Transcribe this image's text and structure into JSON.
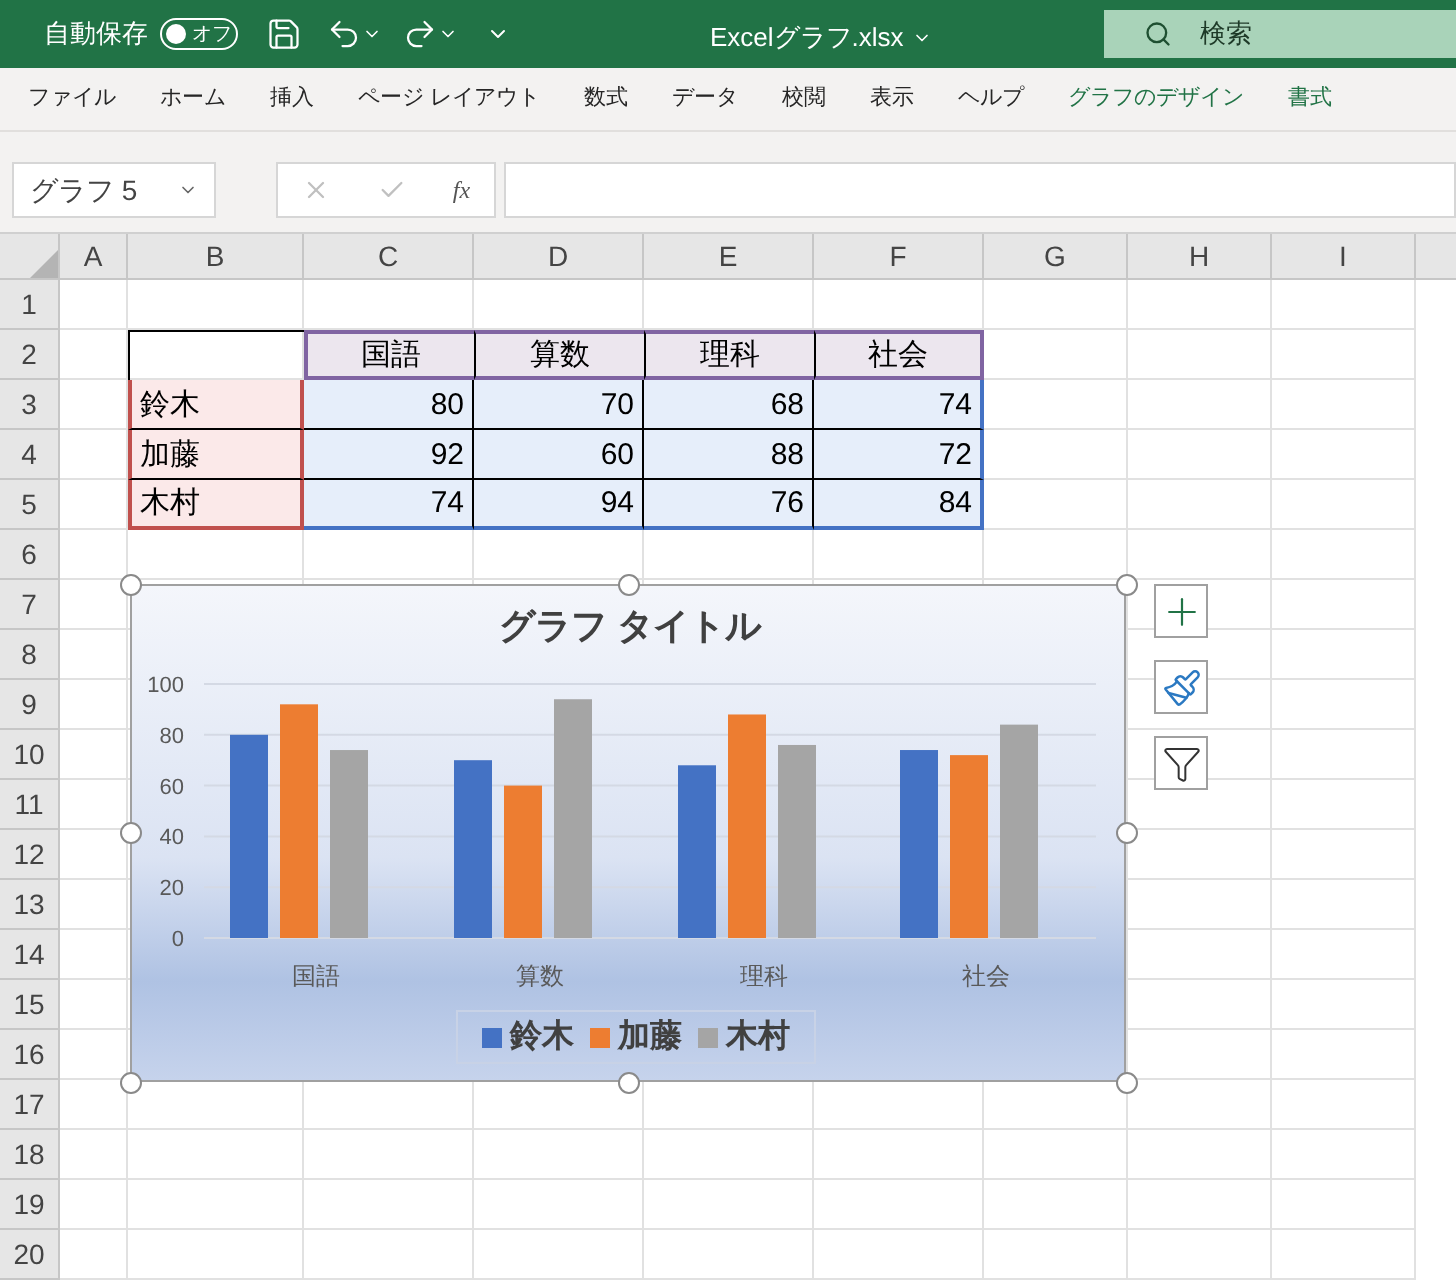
{
  "title_bar": {
    "autosave_label": "自動保存",
    "autosave_toggle": {
      "label": "オフ",
      "on": false
    },
    "filename": "Excelグラフ.xlsx",
    "search_placeholder": "検索"
  },
  "ribbon_tabs": [
    {
      "label": "ファイル",
      "contextual": false
    },
    {
      "label": "ホーム",
      "contextual": false
    },
    {
      "label": "挿入",
      "contextual": false
    },
    {
      "label": "ページ レイアウト",
      "contextual": false
    },
    {
      "label": "数式",
      "contextual": false
    },
    {
      "label": "データ",
      "contextual": false
    },
    {
      "label": "校閲",
      "contextual": false
    },
    {
      "label": "表示",
      "contextual": false
    },
    {
      "label": "ヘルプ",
      "contextual": false
    },
    {
      "label": "グラフのデザイン",
      "contextual": true
    },
    {
      "label": "書式",
      "contextual": true
    }
  ],
  "formula_bar": {
    "name_box": "グラフ 5",
    "fx": "fx"
  },
  "sheet": {
    "column_headers": [
      "A",
      "B",
      "C",
      "D",
      "E",
      "F",
      "G",
      "H",
      "I"
    ],
    "row_headers": [
      "1",
      "2",
      "3",
      "4",
      "5",
      "6",
      "7",
      "8",
      "9",
      "10",
      "11",
      "12",
      "13",
      "14",
      "15",
      "16",
      "17",
      "18",
      "19",
      "20"
    ],
    "table": {
      "header": [
        "国語",
        "算数",
        "理科",
        "社会"
      ],
      "rows": [
        {
          "name": "鈴木",
          "values": [
            "80",
            "70",
            "68",
            "74"
          ]
        },
        {
          "name": "加藤",
          "values": [
            "92",
            "60",
            "88",
            "72"
          ]
        },
        {
          "name": "木村",
          "values": [
            "74",
            "94",
            "76",
            "84"
          ]
        }
      ]
    }
  },
  "chart": {
    "chart_data": {
      "type": "bar",
      "title": "グラフ タイトル",
      "categories": [
        "国語",
        "算数",
        "理科",
        "社会"
      ],
      "series": [
        {
          "name": "鈴木",
          "color": "#4472c4",
          "values": [
            80,
            70,
            68,
            74
          ]
        },
        {
          "name": "加藤",
          "color": "#ed7d31",
          "values": [
            92,
            60,
            88,
            72
          ]
        },
        {
          "name": "木村",
          "color": "#a5a5a5",
          "values": [
            74,
            94,
            76,
            84
          ]
        }
      ],
      "ylim": [
        0,
        100
      ],
      "yticks": [
        {
          "value": 0,
          "label": "0"
        },
        {
          "value": 20,
          "label": "20"
        },
        {
          "value": 40,
          "label": "40"
        },
        {
          "value": 60,
          "label": "60"
        },
        {
          "value": 80,
          "label": "80"
        },
        {
          "value": 100,
          "label": "100"
        }
      ],
      "grid": true,
      "legend": true
    }
  }
}
